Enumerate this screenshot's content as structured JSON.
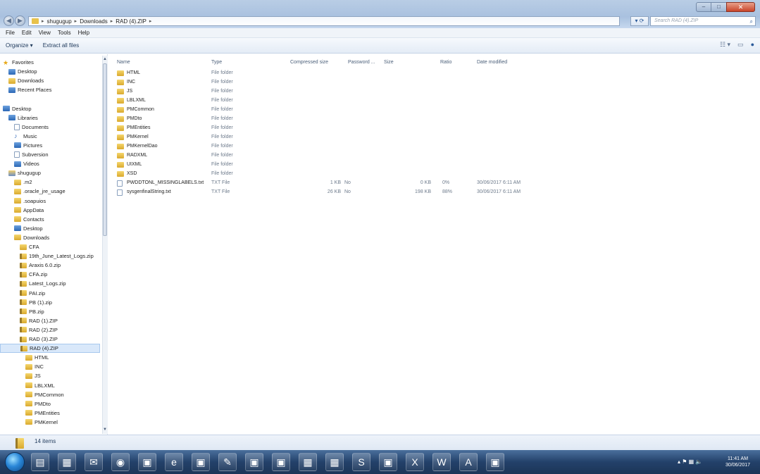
{
  "address": {
    "crumbs": [
      "shugugup",
      "Downloads",
      "RAD (4).ZIP"
    ],
    "search_placeholder": "Search RAD (4).ZIP"
  },
  "menu": [
    "File",
    "Edit",
    "View",
    "Tools",
    "Help"
  ],
  "commands": {
    "organize": "Organize ▾",
    "extract": "Extract all files"
  },
  "nav": [
    {
      "label": "Favorites",
      "icon": "star-icon",
      "indent": 0
    },
    {
      "label": "Desktop",
      "icon": "desktop-icon",
      "indent": 1
    },
    {
      "label": "Downloads",
      "icon": "downloads-icon",
      "indent": 1
    },
    {
      "label": "Recent Places",
      "icon": "recent-icon",
      "indent": 1
    },
    {
      "label": "",
      "icon": "",
      "indent": 0
    },
    {
      "label": "Desktop",
      "icon": "desktop-icon",
      "indent": 0
    },
    {
      "label": "Libraries",
      "icon": "libraries-icon",
      "indent": 1
    },
    {
      "label": "Documents",
      "icon": "document-icon",
      "indent": 2
    },
    {
      "label": "Music",
      "icon": "music-icon",
      "indent": 2
    },
    {
      "label": "Pictures",
      "icon": "pictures-icon",
      "indent": 2
    },
    {
      "label": "Subversion",
      "icon": "document-icon",
      "indent": 2
    },
    {
      "label": "Videos",
      "icon": "videos-icon",
      "indent": 2
    },
    {
      "label": "shugugup",
      "icon": "user-icon",
      "indent": 1
    },
    {
      "label": ".m2",
      "icon": "folder-icon",
      "indent": 2
    },
    {
      "label": ".oracle_jre_usage",
      "icon": "folder-icon",
      "indent": 2
    },
    {
      "label": ".soapuios",
      "icon": "folder-icon",
      "indent": 2
    },
    {
      "label": "AppData",
      "icon": "folder-icon",
      "indent": 2
    },
    {
      "label": "Contacts",
      "icon": "folder-icon",
      "indent": 2
    },
    {
      "label": "Desktop",
      "icon": "desktop-icon",
      "indent": 2
    },
    {
      "label": "Downloads",
      "icon": "downloads-icon",
      "indent": 2
    },
    {
      "label": "CFA",
      "icon": "folder-icon",
      "indent": 3
    },
    {
      "label": "19th_June_Latest_Logs.zip",
      "icon": "zip-icon",
      "indent": 3
    },
    {
      "label": "Araxis 6.0.zip",
      "icon": "zip-icon",
      "indent": 3
    },
    {
      "label": "CFA.zip",
      "icon": "zip-icon",
      "indent": 3
    },
    {
      "label": "Latest_Logs.zip",
      "icon": "zip-icon",
      "indent": 3
    },
    {
      "label": "PAI.zip",
      "icon": "zip-icon",
      "indent": 3
    },
    {
      "label": "PB (1).zip",
      "icon": "zip-icon",
      "indent": 3
    },
    {
      "label": "PB.zip",
      "icon": "zip-icon",
      "indent": 3
    },
    {
      "label": "RAD (1).ZIP",
      "icon": "zip-icon",
      "indent": 3
    },
    {
      "label": "RAD (2).ZIP",
      "icon": "zip-icon",
      "indent": 3
    },
    {
      "label": "RAD (3).ZIP",
      "icon": "zip-icon",
      "indent": 3
    },
    {
      "label": "RAD (4).ZIP",
      "icon": "zip-icon",
      "indent": 3,
      "selected": true
    },
    {
      "label": "HTML",
      "icon": "folder-icon",
      "indent": 4
    },
    {
      "label": "INC",
      "icon": "folder-icon",
      "indent": 4
    },
    {
      "label": "JS",
      "icon": "folder-icon",
      "indent": 4
    },
    {
      "label": "LBLXML",
      "icon": "folder-icon",
      "indent": 4
    },
    {
      "label": "PMCommon",
      "icon": "folder-icon",
      "indent": 4
    },
    {
      "label": "PMDto",
      "icon": "folder-icon",
      "indent": 4
    },
    {
      "label": "PMEntities",
      "icon": "folder-icon",
      "indent": 4
    },
    {
      "label": "PMKernel",
      "icon": "folder-icon",
      "indent": 4
    }
  ],
  "columns": [
    "Name",
    "Type",
    "Compressed size",
    "Password ...",
    "Size",
    "Ratio",
    "Date modified"
  ],
  "files": [
    {
      "name": "HTML",
      "type": "File folder",
      "csize": "",
      "pw": "",
      "size": "",
      "ratio": "",
      "date": "",
      "icon": "folder-icon"
    },
    {
      "name": "INC",
      "type": "File folder",
      "csize": "",
      "pw": "",
      "size": "",
      "ratio": "",
      "date": "",
      "icon": "folder-icon"
    },
    {
      "name": "JS",
      "type": "File folder",
      "csize": "",
      "pw": "",
      "size": "",
      "ratio": "",
      "date": "",
      "icon": "folder-icon"
    },
    {
      "name": "LBLXML",
      "type": "File folder",
      "csize": "",
      "pw": "",
      "size": "",
      "ratio": "",
      "date": "",
      "icon": "folder-icon"
    },
    {
      "name": "PMCommon",
      "type": "File folder",
      "csize": "",
      "pw": "",
      "size": "",
      "ratio": "",
      "date": "",
      "icon": "folder-icon"
    },
    {
      "name": "PMDto",
      "type": "File folder",
      "csize": "",
      "pw": "",
      "size": "",
      "ratio": "",
      "date": "",
      "icon": "folder-icon"
    },
    {
      "name": "PMEntities",
      "type": "File folder",
      "csize": "",
      "pw": "",
      "size": "",
      "ratio": "",
      "date": "",
      "icon": "folder-icon"
    },
    {
      "name": "PMKernel",
      "type": "File folder",
      "csize": "",
      "pw": "",
      "size": "",
      "ratio": "",
      "date": "",
      "icon": "folder-icon"
    },
    {
      "name": "PMKernelDao",
      "type": "File folder",
      "csize": "",
      "pw": "",
      "size": "",
      "ratio": "",
      "date": "",
      "icon": "folder-icon"
    },
    {
      "name": "RADXML",
      "type": "File folder",
      "csize": "",
      "pw": "",
      "size": "",
      "ratio": "",
      "date": "",
      "icon": "folder-icon"
    },
    {
      "name": "UIXML",
      "type": "File folder",
      "csize": "",
      "pw": "",
      "size": "",
      "ratio": "",
      "date": "",
      "icon": "folder-icon"
    },
    {
      "name": "XSD",
      "type": "File folder",
      "csize": "",
      "pw": "",
      "size": "",
      "ratio": "",
      "date": "",
      "icon": "folder-icon"
    },
    {
      "name": "PWDDTONL_MISSINGLABELS.txt",
      "type": "TXT File",
      "csize": "1 KB",
      "pw": "No",
      "size": "0 KB",
      "ratio": "0%",
      "date": "30/06/2017 6:11 AM",
      "icon": "text-file-icon"
    },
    {
      "name": "sysgenfinalString.txt",
      "type": "TXT File",
      "csize": "26 KB",
      "pw": "No",
      "size": "198 KB",
      "ratio": "88%",
      "date": "30/06/2017 6:11 AM",
      "icon": "text-file-icon"
    }
  ],
  "status": {
    "count": "14 items"
  },
  "taskbar": {
    "clock_time": "11:41 AM",
    "clock_date": "30/06/2017",
    "apps": [
      "explorer-icon",
      "folder-icon",
      "outlook-icon",
      "chrome-icon",
      "app-icon",
      "ie-icon",
      "app-icon",
      "paint-icon",
      "app-icon",
      "app-icon",
      "folder-icon",
      "folder-icon",
      "skype-icon",
      "app-icon",
      "excel-icon",
      "word-icon",
      "acrobat-icon",
      "app-icon"
    ]
  }
}
